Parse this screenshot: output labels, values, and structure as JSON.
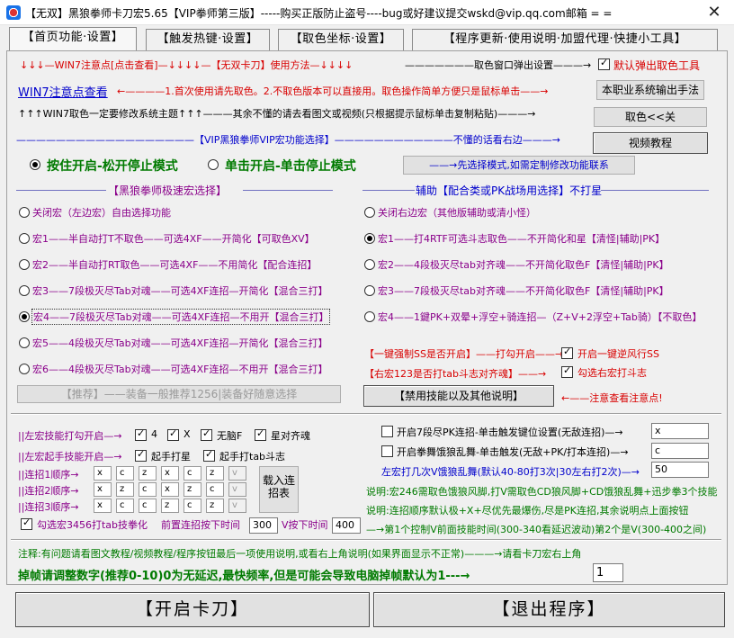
{
  "window": {
    "title": "【无双】黑狼拳师卡刀宏5.65【VIP拳师第三版】-----购买正版防止盗号----bug或好建议提交wskd@vip.qq.com邮箱 = =",
    "close": "✕"
  },
  "tabs": [
    {
      "label": "【首页功能·设置】"
    },
    {
      "label": "【触发热键·设置】"
    },
    {
      "label": "【取色坐标·设置】"
    },
    {
      "label": "【程序更新·使用说明·加盟代理·快捷小工具】"
    }
  ],
  "top": {
    "line1_left": "↓↓↓—WIN7注意点[点击查看]—↓↓↓↓—【无双卡刀】使用方法—↓↓↓↓",
    "line1_mid": "———————取色窗口弹出设置———→",
    "line1_check": "默认弹出取色工具",
    "win7_link": "WIN7注意点查看",
    "line2_note": "←————1.首次使用请先取色。2.不取色版本可以直接用。取色操作简单方便只是鼠标单击——→",
    "btn_job": "本职业系统输出手法",
    "line3": "↑↑↑WIN7取色一定要修改系统主题↑↑↑———其余不懂的请去看图文或视频(只根据提示鼠标单击复制粘贴)———→",
    "btn_pick": "取色<<关",
    "vip_line": "——————————————————【VIP黑狼拳师VIP宏功能选择】————————————不懂的话看右边———→",
    "btn_video": "视频教程"
  },
  "mode": {
    "opt1": "按住开启-松开停止模式",
    "opt2": "单击开启-单击停止模式",
    "hint": "——→先选择模式,如需定制修改功能联系"
  },
  "left_macros": {
    "header": "【黑狼拳师极速宏选择】",
    "items": [
      {
        "label": "关闭宏（左边宏）自由选择功能",
        "checked": false
      },
      {
        "label": "宏1——半自动打T不取色——可选4XF——开简化【可取色XV】",
        "checked": false
      },
      {
        "label": "宏2——半自动打RT取色——可选4XF——不用简化【配合连招】",
        "checked": false
      },
      {
        "label": "宏3——7段极灭尽Tab对魂——可选4XF连招—开简化【混合三打】",
        "checked": false
      },
      {
        "label": "宏4——7段极灭尽Tab对魂——可选4XF连招—不用开【混合三打】",
        "checked": true
      },
      {
        "label": "宏5——4段极灭尽Tab对魂——可选4XF连招—开简化【混合三打】",
        "checked": false
      },
      {
        "label": "宏6——4段极灭尽Tab对魂——可选4XF连招—不用开【混合三打】",
        "checked": false
      }
    ],
    "recommend_btn": "【推荐】——装备一般推荐1256|装备好随意选择"
  },
  "right_macros": {
    "header": "辅助【配合类或PK战场用选择】不打星",
    "items": [
      {
        "label": "关闭右边宏（其他版辅助或清小怪）",
        "checked": false
      },
      {
        "label": "宏1——打4RTF可选斗志取色——不开简化和星【清怪|辅助|PK】",
        "checked": true
      },
      {
        "label": "宏2——4段极灭尽tab对齐魂——不开简化取色F【清怪|辅助|PK】",
        "checked": false
      },
      {
        "label": "宏3——7段极灭尽tab对齐魂——不开简化取色F【清怪|辅助|PK】",
        "checked": false
      },
      {
        "label": "宏4——1鍵PK+双晕+浮空+骑连招—（Z+V+2浮空+Tab骑）【不取色】",
        "checked": false
      }
    ],
    "force_line": "【一键强制SS是否开启】——打勾开启——→",
    "force_check": "开启一键逆风行SS",
    "right123_line": "【右宏123是否打tab斗志对齐魂】——→",
    "right123_check": "勾选右宏打斗志",
    "ban_btn": "【禁用技能以及其他说明】",
    "ban_note": "←——注意查看注意点!"
  },
  "skills": {
    "left_hit": "||左宏技能打勾开启—→",
    "hit_checks": [
      {
        "label": "4",
        "checked": true
      },
      {
        "label": "X",
        "checked": true
      },
      {
        "label": "无脑F",
        "checked": true
      },
      {
        "label": "星对齐魂",
        "checked": true
      }
    ],
    "left_start": "||左宏起手技能开启—→",
    "start_checks": [
      {
        "label": "起手打星",
        "checked": true
      },
      {
        "label": "起手打tab斗志",
        "checked": true
      }
    ],
    "combo_rows": [
      {
        "label": "||连招1顺序→",
        "keys": [
          "x",
          "c",
          "z",
          "x",
          "c",
          "z",
          "v"
        ]
      },
      {
        "label": "||连招2顺序→",
        "keys": [
          "x",
          "z",
          "c",
          "x",
          "z",
          "c",
          "v"
        ]
      },
      {
        "label": "||连招3顺序→",
        "keys": [
          "x",
          "c",
          "c",
          "z",
          "c",
          "z",
          "v"
        ]
      }
    ],
    "load_btn": "载入连招表",
    "left_3456": "勾选宏3456打tab技拳化",
    "delay_label": "前置连招按下时间",
    "delay_val": "300",
    "v_label": "V按下时间",
    "v_val": "400"
  },
  "right_settings": {
    "pk_check": "开启7段尽PK连招-单击触发键位设置(无敌连招)—→",
    "pk_val": "x",
    "fist_check": "开启拳舞饿狼乱舞-单击触发(无敌+PK/打本连招)—→",
    "fist_val": "c",
    "times_label": "左宏打几次V饿狼乱舞(默认40-80打3次|30左右打2次)—→",
    "times_val": "50",
    "note1": "说明:宏246需取色饿狼风脚,打V需取色CD狼风脚+CD饿狼乱舞+迅步拳3个技能",
    "note2": "说明:连招顺序默认极+X+尽优先最爆伤,尽是PK连招,其余说明点上面按钮",
    "note3": "—→第1个控制V前面技能时间(300-340看延迟波动)第2个是V(300-400之间)"
  },
  "footer": {
    "note": "注释:有问题请看图文教程/视频教程/程序按钮最后一项使用说明,或看右上角说明(如果界面显示不正常)———→请看卡刀宏右上角",
    "frame_text": "掉帧请调整数字(推荐0-10)0为无延迟,最快频率,但是可能会导致电脑掉帧默认为1---→",
    "frame_val": "1",
    "start_btn": "【开启卡刀】",
    "exit_btn": "【退出程序】"
  },
  "colors": {
    "accent_red": "#d80000",
    "accent_blue": "#0000cc",
    "accent_purple": "#8a008a",
    "accent_green": "#007a00"
  }
}
